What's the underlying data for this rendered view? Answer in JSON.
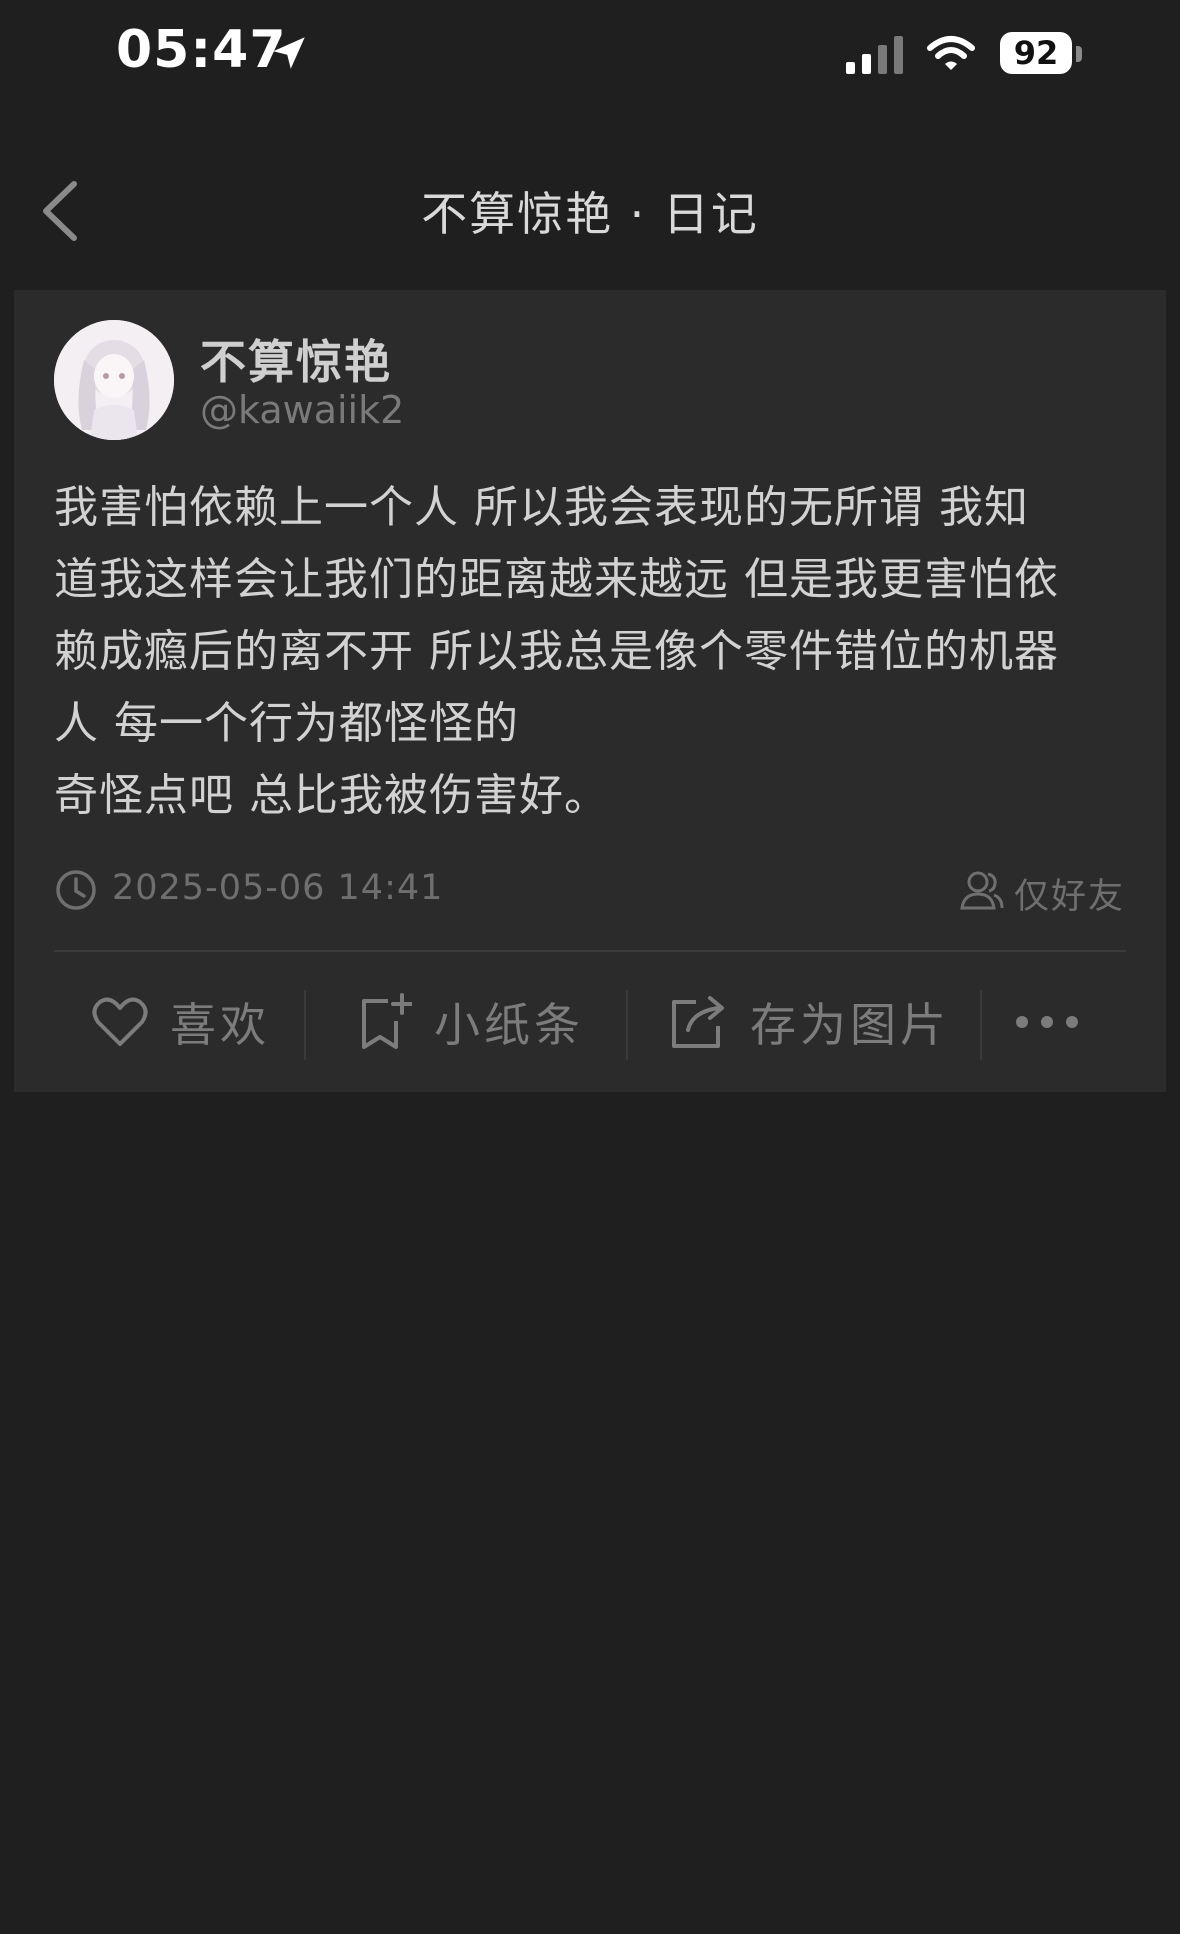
{
  "status_bar": {
    "time": "05:47",
    "battery": "92"
  },
  "nav": {
    "title": "不算惊艳 · 日记"
  },
  "post": {
    "author_name": "不算惊艳",
    "author_handle": "@kawaiik2",
    "text": "我害怕依赖上一个人 所以我会表现的无所谓 我知\n道我这样会让我们的距离越来越远 但是我更害怕依\n赖成瘾后的离不开 所以我总是像个零件错位的机器\n人 每一个行为都怪怪的\n奇怪点吧 总比我被伤害好。",
    "timestamp": "2025-05-06 14:41",
    "visibility": "仅好友"
  },
  "actions": {
    "like": "喜欢",
    "note": "小纸条",
    "save_image": "存为图片"
  },
  "icons": {
    "location": "location-arrow-icon",
    "signal": "cellular-signal-icon",
    "wifi": "wifi-icon",
    "back": "chevron-left-icon",
    "clock": "clock-icon",
    "friends": "friends-icon",
    "heart": "heart-icon",
    "note": "note-add-icon",
    "share": "share-icon",
    "more": "more-dots-icon"
  }
}
